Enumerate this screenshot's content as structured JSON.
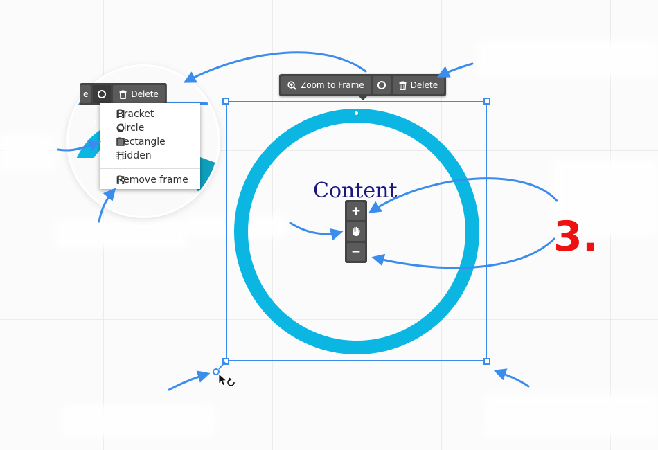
{
  "colors": {
    "accent_blue": "#3b8ded",
    "ring_cyan": "#0bb7e2",
    "toolbar_dark": "#444444",
    "content_navy": "#1d1580",
    "step_red": "#ee1111"
  },
  "main_toolbar": {
    "zoom_to_frame_label": "Zoom to Frame",
    "zoom_icon": "zoom-in-icon",
    "frame_shape_icon": "circle-icon",
    "delete_label": "Delete",
    "delete_icon": "trash-icon"
  },
  "frame": {
    "content_label": "Content",
    "zoom_controls": {
      "zoom_in": "+",
      "zoom_out": "−",
      "pan_icon": "hand-icon"
    }
  },
  "zoom_callout": {
    "toolbar": {
      "partial_label": "e",
      "delete_label": "Delete"
    },
    "frame_menu": {
      "items": [
        {
          "label": "Bracket",
          "icon": "bracket-icon"
        },
        {
          "label": "Circle",
          "icon": "circle-outline-icon"
        },
        {
          "label": "Rectangle",
          "icon": "rectangle-filled-icon"
        },
        {
          "label": "Hidden",
          "icon": "dashed-square-icon"
        }
      ],
      "remove_label": "Remove frame",
      "remove_icon": "remove-frame-icon"
    }
  },
  "step_number": "3."
}
